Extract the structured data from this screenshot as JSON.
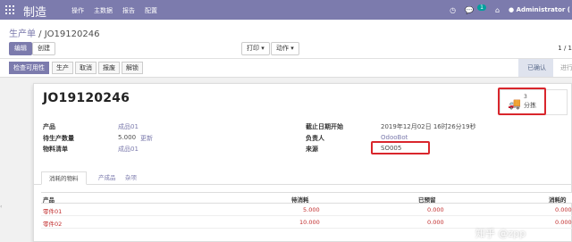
{
  "navbar": {
    "brand": "制造",
    "menu": [
      "操作",
      "主数据",
      "报告",
      "配置"
    ],
    "chat_badge": "1",
    "user": "Administrator (",
    "colors": {
      "bar": "#7c7bad",
      "badge": "#00a09d"
    }
  },
  "control": {
    "breadcrumb_parent": "生产单",
    "breadcrumb_sep": " / ",
    "breadcrumb_current": "JO19120246",
    "edit_label": "编辑",
    "create_label": "创建",
    "print_label": "打印 ▾",
    "action_label": "动作 ▾",
    "pager": "1 / 1"
  },
  "statusbar": {
    "check_label": "检查可用性",
    "produce_label": "生产",
    "cancel_label": "取消",
    "scrap_label": "报废",
    "unlock_label": "解锁",
    "stage_confirmed": "已确认",
    "stage_progress": "进行"
  },
  "form": {
    "title": "JO19120246",
    "smart_count": "3",
    "smart_label": "分拣",
    "fields": {
      "product_label": "产品",
      "product_value": "成品01",
      "qty_label": "待生产数量",
      "qty_value": "5.000",
      "qty_update": "更新",
      "bom_label": "物料清单",
      "bom_value": "成品01",
      "deadline_label": "截止日期开始",
      "deadline_value": "2019年12月02日 16时26分19秒",
      "responsible_label": "负责人",
      "responsible_value": "OdooBot",
      "source_label": "来源",
      "source_value": "SO005"
    },
    "tabs": [
      "消耗的物料",
      "产成品",
      "杂项"
    ],
    "table": {
      "headers": [
        "产品",
        "待消耗",
        "已预留",
        "消耗的"
      ],
      "rows": [
        {
          "product": "零件01",
          "to_consume": "5.000",
          "reserved": "0.000",
          "consumed": "0.000"
        },
        {
          "product": "零件02",
          "to_consume": "10.000",
          "reserved": "0.000",
          "consumed": "0.000"
        }
      ]
    }
  },
  "watermark": "知乎 @zpp"
}
